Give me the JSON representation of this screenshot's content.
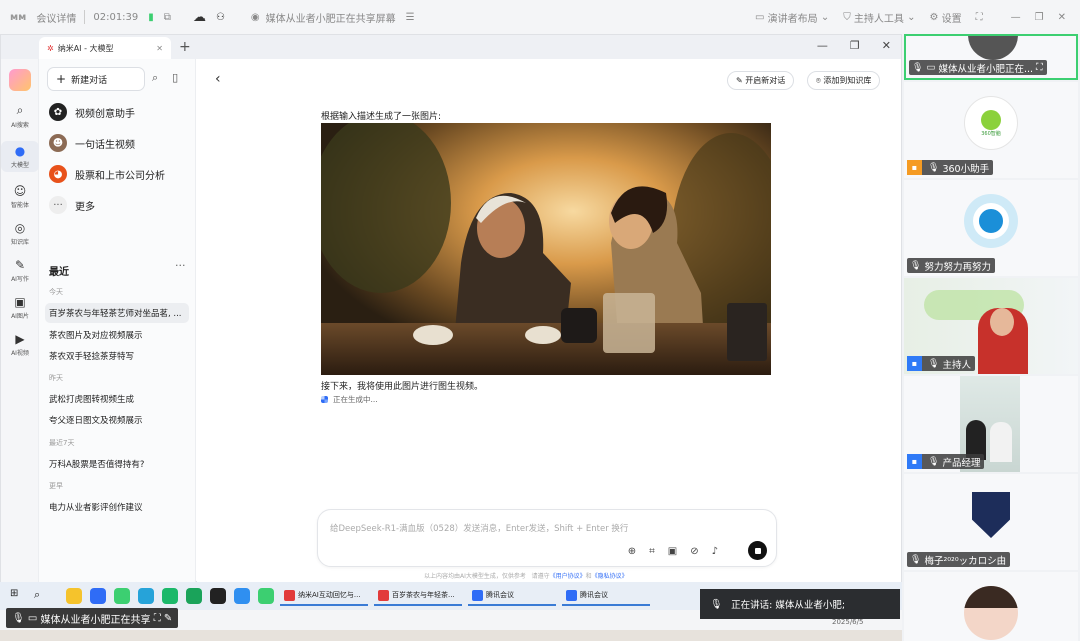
{
  "meeting": {
    "details": "会议详情",
    "timer": "02:01:39",
    "share_title": "媒体从业者小肥正在共享屏幕",
    "speaker_layout": "演讲者布局",
    "host_tools": "主持人工具",
    "settings": "设置"
  },
  "browser": {
    "tab_title": "纳米AI - 大模型"
  },
  "rail": [
    {
      "label": "AI搜索",
      "icon": "search-icon"
    },
    {
      "label": "大模型",
      "icon": "model-icon"
    },
    {
      "label": "智能体",
      "icon": "agent-icon"
    },
    {
      "label": "知识库",
      "icon": "knowledge-icon"
    },
    {
      "label": "AI写作",
      "icon": "pen-icon"
    },
    {
      "label": "AI图片",
      "icon": "image-icon"
    },
    {
      "label": "AI视频",
      "icon": "video-icon"
    }
  ],
  "sidebar": {
    "new_chat": "新建对话",
    "features": [
      {
        "label": "视频创意助手",
        "color": "#222222"
      },
      {
        "label": "一句话生视频",
        "color": "#8c6b55"
      },
      {
        "label": "股票和上市公司分析",
        "color": "#e8521b"
      },
      {
        "label": "更多",
        "color": "#eeeeee"
      }
    ],
    "recent": "最近",
    "groups": [
      {
        "label": "今天",
        "items": [
          "百岁茶农与年轻茶艺师对坐品茗, ...",
          "茶农图片及对应视频展示",
          "茶农双手轻捻茶芽特写"
        ]
      },
      {
        "label": "昨天",
        "items": [
          "武松打虎图转视频生成",
          "夸父逐日图文及视频展示"
        ]
      },
      {
        "label": "最近7天",
        "items": [
          "万科A股票是否值得持有?"
        ]
      },
      {
        "label": "更早",
        "items": [
          "电力从业者影评创作建议"
        ]
      }
    ]
  },
  "main": {
    "new_chat_btn": "开启新对话",
    "add_kb_btn": "添加到知识库",
    "caption": "根据输入描述生成了一张图片:",
    "after": "接下来，我将使用此图片进行图生视频。",
    "generating": "正在生成中...",
    "input_placeholder": "给DeepSeek-R1-满血版（0528）发送消息，Enter发送，Shift + Enter 换行",
    "disclaimer_pre": "以上内容均由AI大模型生成，仅供参考",
    "disclaimer_mid": "请遵守",
    "user_agreement": "《用户协议》",
    "and": "和",
    "privacy": "《隐私协议》"
  },
  "taskbar": {
    "apps": [
      {
        "label": "纳米AI互动回忆与...",
        "color": "#e23b3b"
      },
      {
        "label": "百岁茶农与年轻茶...",
        "color": "#e23b3b"
      },
      {
        "label": "腾讯会议",
        "color": "#2f6cf6"
      },
      {
        "label": "腾讯会议",
        "color": "#2f6cf6"
      }
    ],
    "sharing": "媒体从业者小肥正在共享",
    "speaking": "正在讲话:  媒体从业者小肥;",
    "date": "2025/6/5"
  },
  "participants": [
    {
      "name": "媒体从业者小肥正在..."
    },
    {
      "name": "360小助手",
      "logo_text": "360智脑"
    },
    {
      "name": "努力努力再努力"
    },
    {
      "name": "主持人"
    },
    {
      "name": "产品经理"
    },
    {
      "name": "梅子²⁰²⁰ッカロシ由"
    }
  ]
}
